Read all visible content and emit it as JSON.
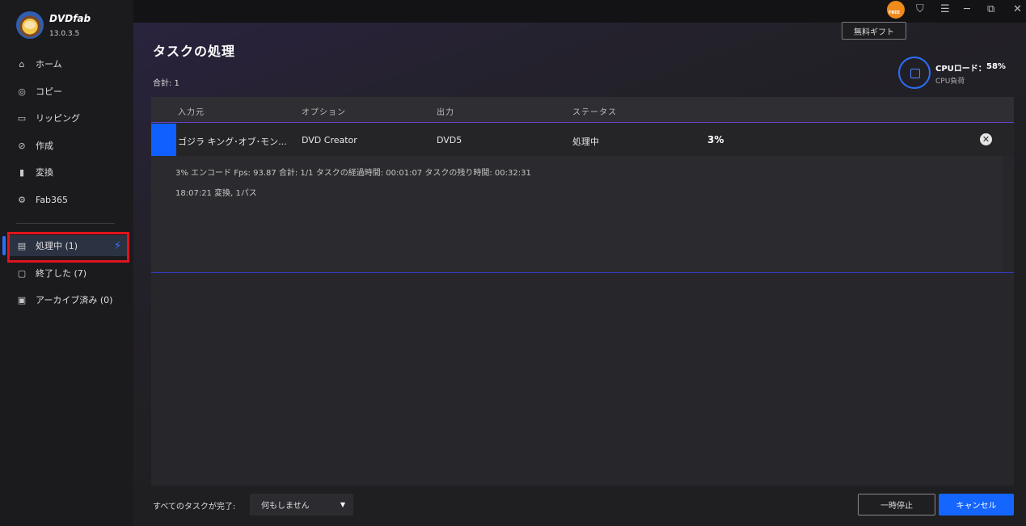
{
  "app": {
    "brand": "DVDfab",
    "version": "13.0.3.5"
  },
  "sidebar": {
    "items": [
      {
        "label": "ホーム",
        "icon": "home-icon"
      },
      {
        "label": "コピー",
        "icon": "copy-icon"
      },
      {
        "label": "リッピング",
        "icon": "ripping-icon"
      },
      {
        "label": "作成",
        "icon": "create-icon"
      },
      {
        "label": "変換",
        "icon": "convert-icon"
      },
      {
        "label": "Fab365",
        "icon": "fab365-icon"
      }
    ],
    "queue": [
      {
        "label": "処理中 (1)",
        "icon": "processing-icon",
        "active": true
      },
      {
        "label": "終了した (7)",
        "icon": "finished-icon"
      },
      {
        "label": "アーカイブ済み (0)",
        "icon": "archive-icon"
      }
    ]
  },
  "titlebar": {
    "tooltip": "無料ギフト"
  },
  "main": {
    "title": "タスクの処理",
    "total": "合計: 1",
    "cpu": {
      "label": "CPUロード：",
      "value": "58%",
      "sub": "CPU負荷"
    }
  },
  "table": {
    "headers": [
      "入力元",
      "オプション",
      "出力",
      "ステータス"
    ],
    "row": {
      "source": "ゴジラ キング･オブ･モン...",
      "option": "DVD Creator",
      "output": "DVD5",
      "status": "処理中",
      "percent": "3%"
    },
    "detail": {
      "line1": "3%  エンコード Fps: 93.87   合計: 1/1  タスクの経過時間: 00:01:07  タスクの残り時間: 00:32:31",
      "line2": "18:07:21  変換, 1パス"
    }
  },
  "footer": {
    "label": "すべてのタスクが完了:",
    "select_value": "何もしません",
    "pause_label": "一時停止",
    "cancel_label": "キャンセル"
  }
}
